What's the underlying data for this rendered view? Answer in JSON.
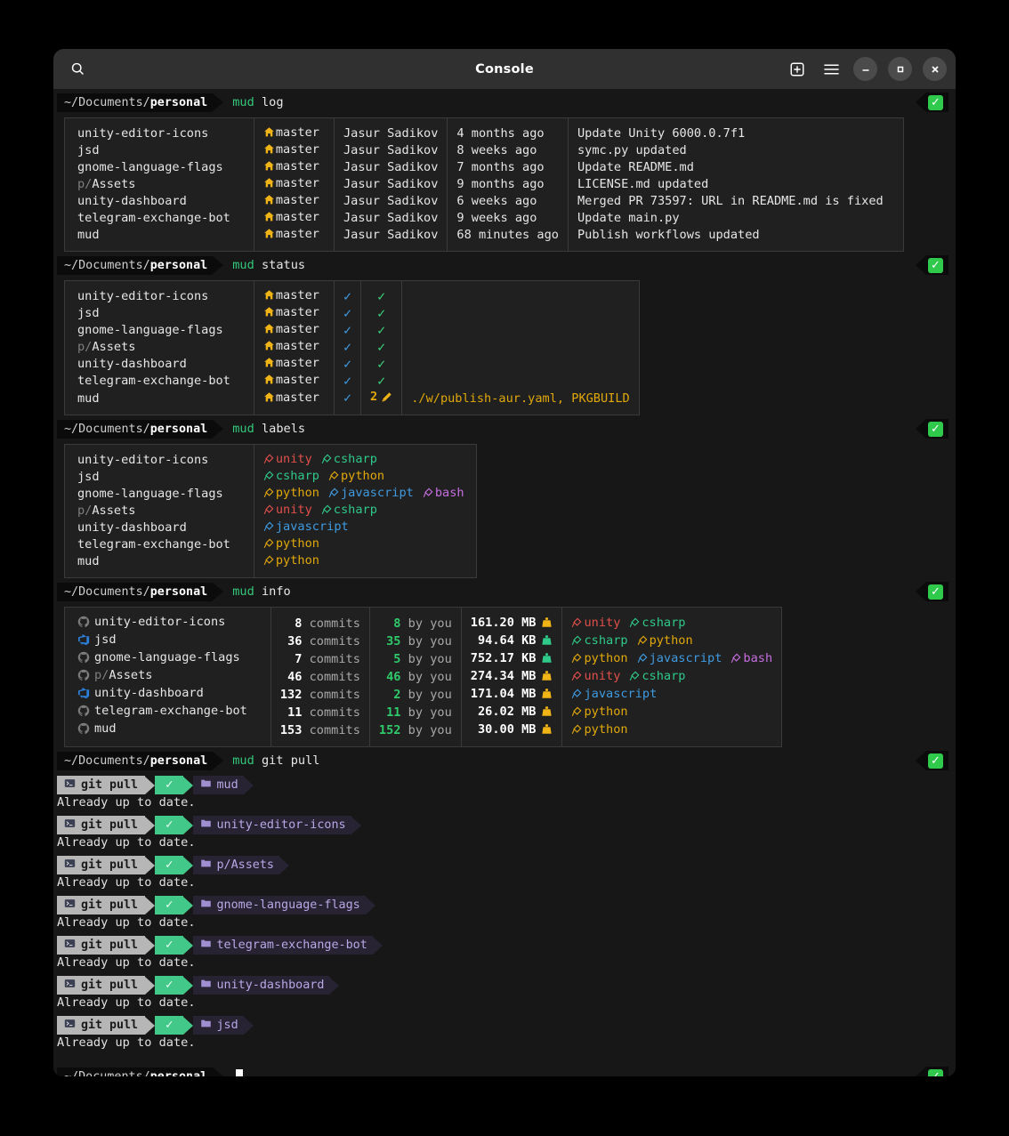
{
  "window": {
    "title": "Console",
    "search_icon": "search-icon",
    "new_tab_icon": "plus-square-icon",
    "menu_icon": "hamburger-menu-icon",
    "minimize_label": "–",
    "maximize_label": "▫",
    "close_label": "✕"
  },
  "colors": {
    "page_bg": "#000000",
    "window_bg": "#171717",
    "titlebar_bg": "#303030",
    "accent_green": "#2fca4c",
    "label_unity": "#e0504b",
    "label_csharp": "#2fc98a",
    "label_python": "#e1a80a",
    "label_javascript": "#3f9ae0",
    "label_bash": "#c76ee0"
  },
  "prompts": {
    "path_prefix": "~/Documents/",
    "path_bold": "personal",
    "status_ok": "✓"
  },
  "commands": {
    "log": {
      "name": "mud",
      "args": "log"
    },
    "status": {
      "name": "mud",
      "args": "status"
    },
    "labels": {
      "name": "mud",
      "args": "labels"
    },
    "info": {
      "name": "mud",
      "args": "info"
    },
    "pull": {
      "name": "mud",
      "args": "git pull"
    }
  },
  "log_table": {
    "rows": [
      {
        "name": "unity-editor-icons",
        "name_prefix": "",
        "branch": "master",
        "author": "Jasur Sadikov",
        "time": "4 months ago",
        "message": "Update Unity 6000.0.7f1"
      },
      {
        "name": "jsd",
        "name_prefix": "",
        "branch": "master",
        "author": "Jasur Sadikov",
        "time": "8 weeks ago",
        "message": "symc.py updated"
      },
      {
        "name": "gnome-language-flags",
        "name_prefix": "",
        "branch": "master",
        "author": "Jasur Sadikov",
        "time": "7 months ago",
        "message": "Update README.md"
      },
      {
        "name": "Assets",
        "name_prefix": "p/",
        "branch": "master",
        "author": "Jasur Sadikov",
        "time": "9 months ago",
        "message": "LICENSE.md updated"
      },
      {
        "name": "unity-dashboard",
        "name_prefix": "",
        "branch": "master",
        "author": "Jasur Sadikov",
        "time": "6 weeks ago",
        "message": "Merged PR 73597: URL in README.md is fixed"
      },
      {
        "name": "telegram-exchange-bot",
        "name_prefix": "",
        "branch": "master",
        "author": "Jasur Sadikov",
        "time": "9 weeks ago",
        "message": "Update main.py"
      },
      {
        "name": "mud",
        "name_prefix": "",
        "branch": "master",
        "author": "Jasur Sadikov",
        "time": "68 minutes ago",
        "message": "Publish workflows updated"
      }
    ]
  },
  "status_table": {
    "rows": [
      {
        "name": "unity-editor-icons",
        "name_prefix": "",
        "branch": "master",
        "sync": "✓",
        "state": "✓",
        "modified": "",
        "files": ""
      },
      {
        "name": "jsd",
        "name_prefix": "",
        "branch": "master",
        "sync": "✓",
        "state": "✓",
        "modified": "",
        "files": ""
      },
      {
        "name": "gnome-language-flags",
        "name_prefix": "",
        "branch": "master",
        "sync": "✓",
        "state": "✓",
        "modified": "",
        "files": ""
      },
      {
        "name": "Assets",
        "name_prefix": "p/",
        "branch": "master",
        "sync": "✓",
        "state": "✓",
        "modified": "",
        "files": ""
      },
      {
        "name": "unity-dashboard",
        "name_prefix": "",
        "branch": "master",
        "sync": "✓",
        "state": "✓",
        "modified": "",
        "files": ""
      },
      {
        "name": "telegram-exchange-bot",
        "name_prefix": "",
        "branch": "master",
        "sync": "✓",
        "state": "✓",
        "modified": "",
        "files": ""
      },
      {
        "name": "mud",
        "name_prefix": "",
        "branch": "master",
        "sync": "✓",
        "state": "",
        "modified": "2",
        "files": "./w/publish-aur.yaml, PKGBUILD"
      }
    ]
  },
  "labels_table": {
    "rows": [
      {
        "name": "unity-editor-icons",
        "name_prefix": "",
        "labels": [
          "unity",
          "csharp"
        ]
      },
      {
        "name": "jsd",
        "name_prefix": "",
        "labels": [
          "csharp",
          "python"
        ]
      },
      {
        "name": "gnome-language-flags",
        "name_prefix": "",
        "labels": [
          "python",
          "javascript",
          "bash"
        ]
      },
      {
        "name": "Assets",
        "name_prefix": "p/",
        "labels": [
          "unity",
          "csharp"
        ]
      },
      {
        "name": "unity-dashboard",
        "name_prefix": "",
        "labels": [
          "javascript"
        ]
      },
      {
        "name": "telegram-exchange-bot",
        "name_prefix": "",
        "labels": [
          "python"
        ]
      },
      {
        "name": "mud",
        "name_prefix": "",
        "labels": [
          "python"
        ]
      }
    ]
  },
  "info_table": {
    "commits_unit": "commits",
    "by_you_unit": "by you",
    "rows": [
      {
        "host": "github",
        "name": "unity-editor-icons",
        "name_prefix": "",
        "commits": "8",
        "by_you": "8",
        "size": "161.20 MB",
        "size_tier": "large",
        "labels": [
          "unity",
          "csharp"
        ]
      },
      {
        "host": "azure",
        "name": "jsd",
        "name_prefix": "",
        "commits": "36",
        "by_you": "35",
        "size": "94.64 KB",
        "size_tier": "small",
        "labels": [
          "csharp",
          "python"
        ]
      },
      {
        "host": "github",
        "name": "gnome-language-flags",
        "name_prefix": "",
        "commits": "7",
        "by_you": "5",
        "size": "752.17 KB",
        "size_tier": "small",
        "labels": [
          "python",
          "javascript",
          "bash"
        ]
      },
      {
        "host": "github",
        "name": "Assets",
        "name_prefix": "p/",
        "commits": "46",
        "by_you": "46",
        "size": "274.34 MB",
        "size_tier": "large",
        "labels": [
          "unity",
          "csharp"
        ]
      },
      {
        "host": "azure",
        "name": "unity-dashboard",
        "name_prefix": "",
        "commits": "132",
        "by_you": "2",
        "size": "171.04 MB",
        "size_tier": "large",
        "labels": [
          "javascript"
        ]
      },
      {
        "host": "github",
        "name": "telegram-exchange-bot",
        "name_prefix": "",
        "commits": "11",
        "by_you": "11",
        "size": "26.02 MB",
        "size_tier": "large",
        "labels": [
          "python"
        ]
      },
      {
        "host": "github",
        "name": "mud",
        "name_prefix": "",
        "commits": "153",
        "by_you": "152",
        "size": "30.00 MB",
        "size_tier": "large",
        "labels": [
          "python"
        ]
      }
    ]
  },
  "pull_results": {
    "command_label": "git pull",
    "status_glyph": "✓",
    "rows": [
      {
        "repo": "mud",
        "output": "Already up to date."
      },
      {
        "repo": "unity-editor-icons",
        "output": "Already up to date."
      },
      {
        "repo": "p/Assets",
        "output": "Already up to date."
      },
      {
        "repo": "gnome-language-flags",
        "output": "Already up to date."
      },
      {
        "repo": "telegram-exchange-bot",
        "output": "Already up to date."
      },
      {
        "repo": "unity-dashboard",
        "output": "Already up to date."
      },
      {
        "repo": "jsd",
        "output": "Already up to date."
      }
    ]
  }
}
